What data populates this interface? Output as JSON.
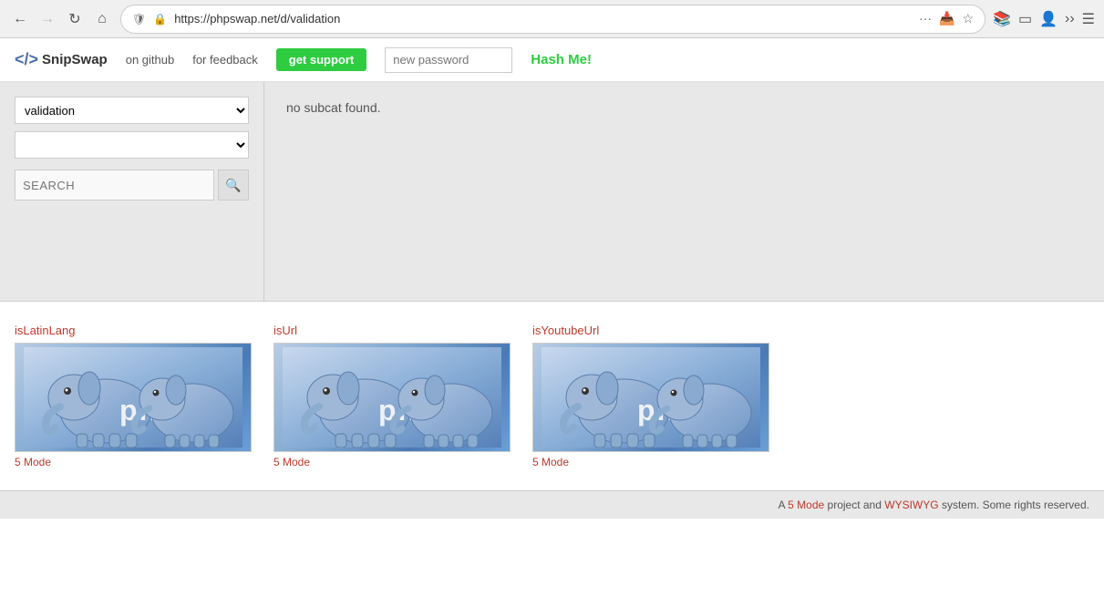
{
  "browser": {
    "url": "https://phpswap.net/d/validation",
    "back_disabled": false,
    "forward_disabled": true
  },
  "header": {
    "logo_text": "SnipSwap",
    "nav_links": [
      {
        "label": "on github",
        "href": "#"
      },
      {
        "label": "for feedback",
        "href": "#"
      }
    ],
    "get_support_label": "get support",
    "password_placeholder": "new password",
    "hash_me_label": "Hash Me!"
  },
  "sidebar": {
    "category_value": "validation",
    "category_options": [
      "validation"
    ],
    "subcategory_value": "",
    "subcategory_options": [],
    "search_placeholder": "SEARCH"
  },
  "content": {
    "no_subcat_message": "no subcat found."
  },
  "snippets": [
    {
      "title": "isLatinLang",
      "mode": "5 Mode"
    },
    {
      "title": "isUrl",
      "mode": "5 Mode"
    },
    {
      "title": "isYoutubeUrl",
      "mode": "5 Mode"
    }
  ],
  "footer": {
    "text": "A ",
    "mode_link": "5 Mode",
    "middle_text": " project and ",
    "wysiwyg_link": "WYSIWYG",
    "end_text": " system. Some rights reserved."
  }
}
